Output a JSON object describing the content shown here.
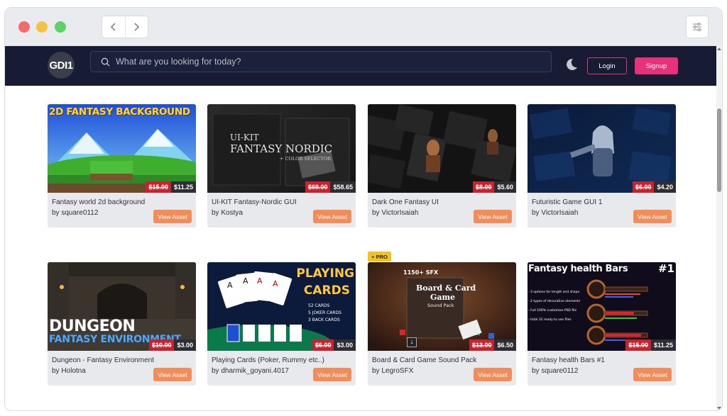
{
  "browser": {
    "back_icon": "chevron-left-icon",
    "forward_icon": "chevron-right-icon",
    "settings_icon": "sliders-icon"
  },
  "header": {
    "logo_text": "GDI1",
    "search_placeholder": "What are you looking for today?",
    "login_label": "Login",
    "signup_label": "Signup",
    "theme_icon": "moon-icon"
  },
  "cards": [
    {
      "title": "Fantasy world 2d background",
      "author": "by square0112",
      "old_price": "$15.00",
      "new_price": "$11.25",
      "view_label": "View Asset",
      "art_text": "2D FANTASY BACKGROUND"
    },
    {
      "title": "UI-KIT Fantasy-Nordic GUI",
      "author": "by Kostya",
      "old_price": "$69.00",
      "new_price": "$58.65",
      "view_label": "View Asset",
      "art_text": "UI-KIT",
      "art_text2": "FANTASY NORDIC",
      "art_text3": "+ COLOR SELECTOR"
    },
    {
      "title": "Dark One Fantasy UI",
      "author": "by VictorIsaiah",
      "old_price": "$8.00",
      "new_price": "$5.60",
      "view_label": "View Asset"
    },
    {
      "title": "Futuristic Game GUI 1",
      "author": "by VictorIsaiah",
      "old_price": "$6.00",
      "new_price": "$4.20",
      "view_label": "View Asset"
    },
    {
      "title": "Dungeon - Fantasy Environment",
      "author": "by Holotna",
      "old_price": "$10.00",
      "new_price": "$3.00",
      "view_label": "View Asset",
      "art_text": "DUNGEON",
      "art_text2": "FANTASY ENVIRONMENT"
    },
    {
      "title": "Playing Cards (Poker, Rummy etc..)",
      "author": "by dharmik_goyani.4017",
      "old_price": "$6.00",
      "new_price": "$3.00",
      "view_label": "View Asset",
      "art_text": "PLAYING",
      "art_text2": "CARDS",
      "art_lines": [
        "52 CARDS",
        "5 JOKER CARDS",
        "3 BACK CARDS"
      ]
    },
    {
      "title": "Board & Card Game Sound Pack",
      "author": "by LegroSFX",
      "old_price": "$13.00",
      "new_price": "$6.50",
      "view_label": "View Asset",
      "art_text": "1150+ SFX",
      "art_text2": "Board & Card",
      "art_text3": "Game",
      "art_text4": "Sound Pack",
      "badge": "+ PRO"
    },
    {
      "title": "Fantasy health Bars #1",
      "author": "by square0112",
      "old_price": "$15.00",
      "new_price": "$11.25",
      "view_label": "View Asset",
      "art_text": "Fantasy health Bars",
      "art_text2": "#1",
      "art_lines": [
        "- 3 options for length and shape",
        "- 2 types of decorative elements",
        "- Full 100% customize PSD file",
        "- total 32 ready to use files"
      ]
    }
  ]
}
